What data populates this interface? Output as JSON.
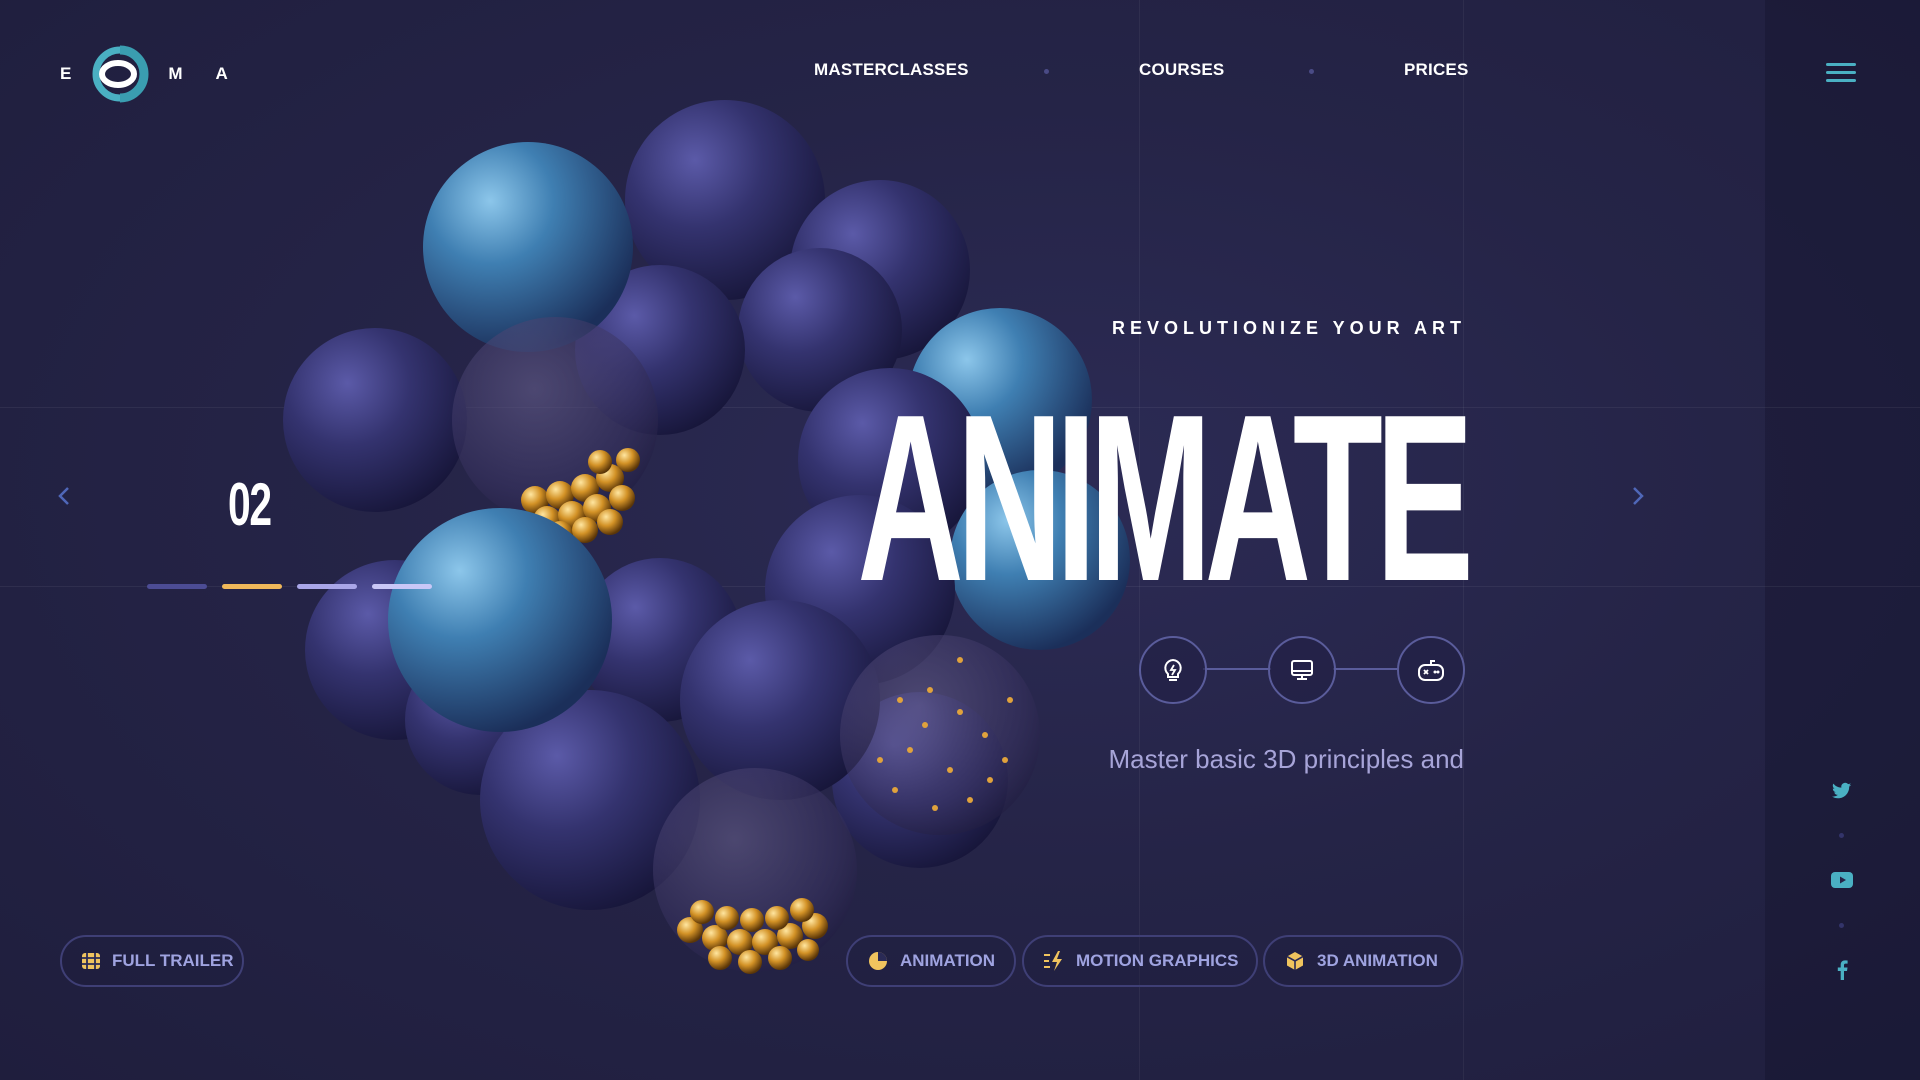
{
  "brand": {
    "letters": [
      "E",
      "M",
      "A"
    ],
    "logo_icon": "logo-mark-icon",
    "accent": "#4ab0c3"
  },
  "nav": {
    "items": [
      "MASTERCLASSES",
      "COURSES",
      "PRICES"
    ],
    "menu_icon": "hamburger-menu-icon"
  },
  "hero": {
    "eyebrow": "REVOLUTIONIZE YOUR ART",
    "title": "ANIMATE",
    "description": "Master basic 3D principles and",
    "feature_icons": [
      "lightbulb-icon",
      "monitor-icon",
      "gamepad-icon"
    ]
  },
  "slider": {
    "number": "02",
    "prev_icon": "chevron-left-icon",
    "next_icon": "chevron-right-icon",
    "progress_colors": [
      "#4c4c94",
      "#f0b85a",
      "#a9a6e8",
      "#c9c7f7"
    ]
  },
  "trailer": {
    "label": "FULL TRAILER",
    "icon": "film-icon"
  },
  "tags": [
    {
      "label": "ANIMATION",
      "icon": "pie-icon"
    },
    {
      "label": "MOTION GRAPHICS",
      "icon": "lightning-list-icon"
    },
    {
      "label": "3D ANIMATION",
      "icon": "cube-icon"
    }
  ],
  "social": [
    "twitter-icon",
    "youtube-icon",
    "facebook-icon"
  ],
  "colors": {
    "background": "#252447",
    "gold": "#f0b85a",
    "muted_text": "#a7a4d8",
    "pill_text": "#9fa3e0"
  }
}
